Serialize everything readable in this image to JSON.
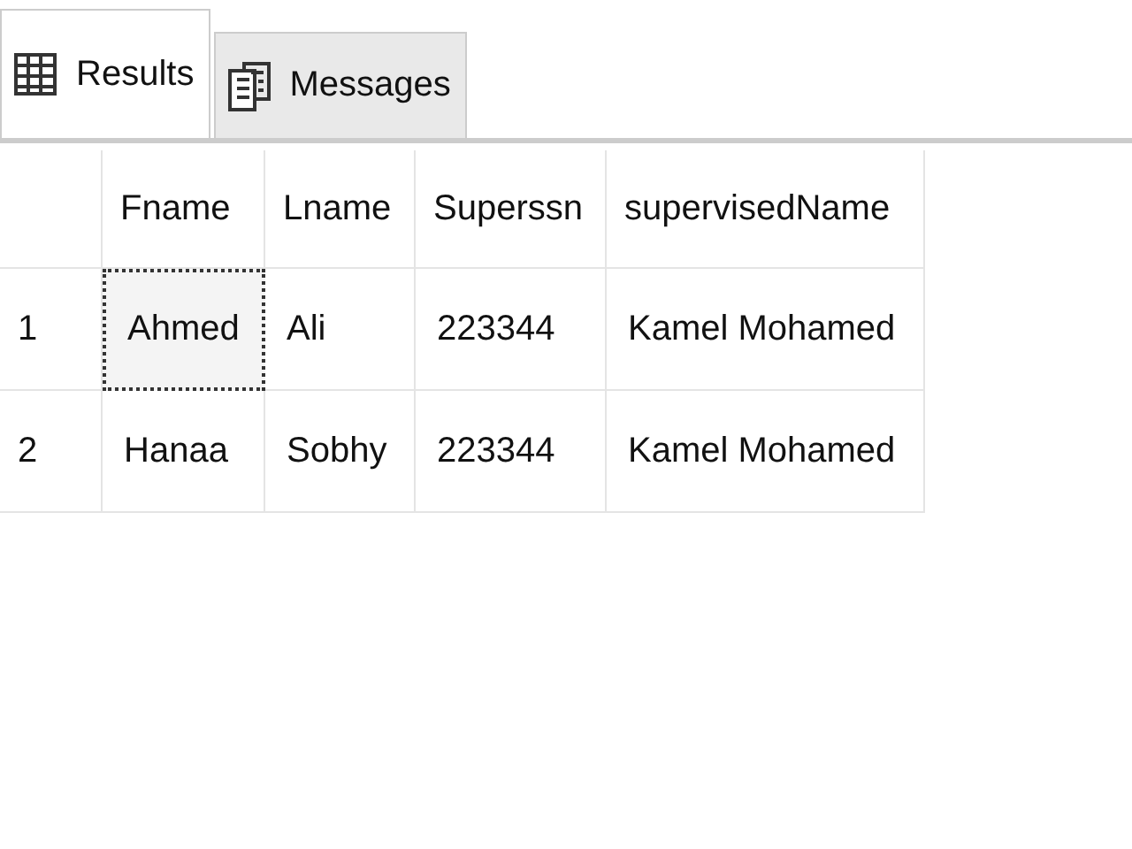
{
  "tabs": [
    {
      "label": "Results",
      "kind": "grid",
      "selected": true
    },
    {
      "label": "Messages",
      "kind": "messages",
      "selected": false
    }
  ],
  "table": {
    "columns": [
      "Fname",
      "Lname",
      "Superssn",
      "supervisedName"
    ],
    "rows": [
      {
        "number": "1",
        "cells": [
          {
            "text": "Ahmed",
            "selected": true
          },
          {
            "text": "Ali",
            "selected": false
          },
          {
            "text": "223344",
            "selected": false
          },
          {
            "text": "Kamel Mohamed",
            "selected": false
          }
        ]
      },
      {
        "number": "2",
        "cells": [
          {
            "text": "Hanaa",
            "selected": false
          },
          {
            "text": "Sobhy",
            "selected": false
          },
          {
            "text": "223344",
            "selected": false
          },
          {
            "text": "Kamel Mohamed",
            "selected": false
          }
        ]
      }
    ]
  }
}
